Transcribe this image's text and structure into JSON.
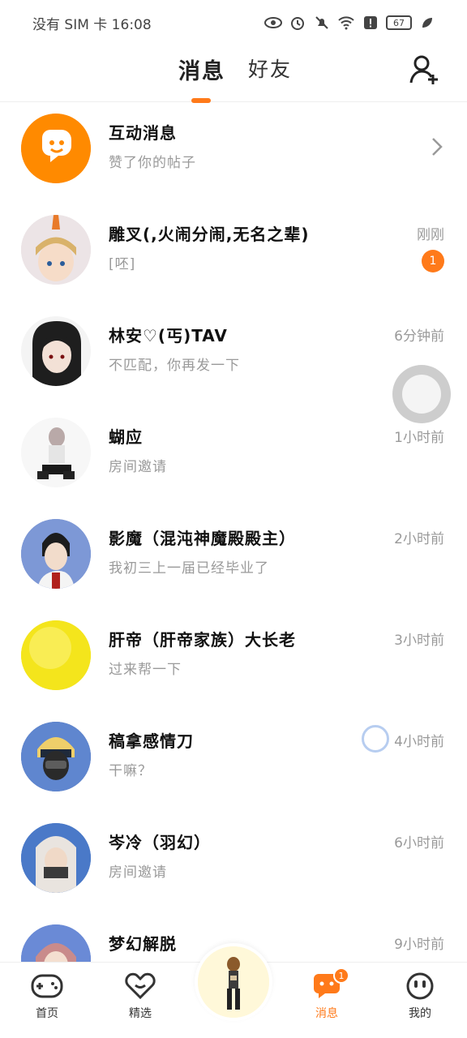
{
  "status_bar": {
    "left": "没有 SIM 卡 16:08",
    "battery": "67"
  },
  "header": {
    "tabs": [
      {
        "label": "消息",
        "active": true
      },
      {
        "label": "好友",
        "active": false
      }
    ],
    "add_friend_icon": "add-user-icon"
  },
  "messages": [
    {
      "name": "互动消息",
      "preview": "赞了你的帖子",
      "time": "",
      "badge": "",
      "avatar_color": "#ff8a00",
      "chevron": true
    },
    {
      "name": "雕叉(,火闹分闹,无名之辈)",
      "preview": "[呸]",
      "time": "刚刚",
      "badge": "1",
      "avatar_color": "#e8dfe0"
    },
    {
      "name": "林安♡(丐)TAV",
      "preview": "不匹配，你再发一下",
      "time": "6分钟前",
      "badge": "",
      "avatar_color": "#2b2b2b"
    },
    {
      "name": "蝴应",
      "preview": "房间邀请",
      "time": "1小时前",
      "badge": "",
      "avatar_color": "#e6e6e6"
    },
    {
      "name": "影魔（混沌神魔殿殿主）",
      "preview": "我初三上一届已经毕业了",
      "time": "2小时前",
      "badge": "",
      "avatar_color": "#6b86c8"
    },
    {
      "name": "肝帝（肝帝家族）大长老",
      "preview": "过来帮一下",
      "time": "3小时前",
      "badge": "",
      "avatar_color": "#f5e61d"
    },
    {
      "name": "稿拿感情刀",
      "preview": "干嘛？",
      "time": "4小时前",
      "badge": "",
      "avatar_color": "#3c5aa0"
    },
    {
      "name": "岑冷（羽幻）",
      "preview": "房间邀请",
      "time": "6小时前",
      "badge": "",
      "avatar_color": "#4a78c2"
    },
    {
      "name": "梦幻解脱",
      "preview": "",
      "time": "9小时前",
      "badge": "",
      "avatar_color": "#5b7fd0"
    }
  ],
  "bottom_nav": {
    "items": [
      {
        "label": "首页",
        "icon": "gamepad-icon"
      },
      {
        "label": "精选",
        "icon": "heart-icon"
      },
      {
        "label": "消息",
        "icon": "message-icon",
        "active": true,
        "badge": "1"
      },
      {
        "label": "我的",
        "icon": "profile-face-icon"
      }
    ]
  },
  "colors": {
    "accent": "#ff7a1a"
  }
}
